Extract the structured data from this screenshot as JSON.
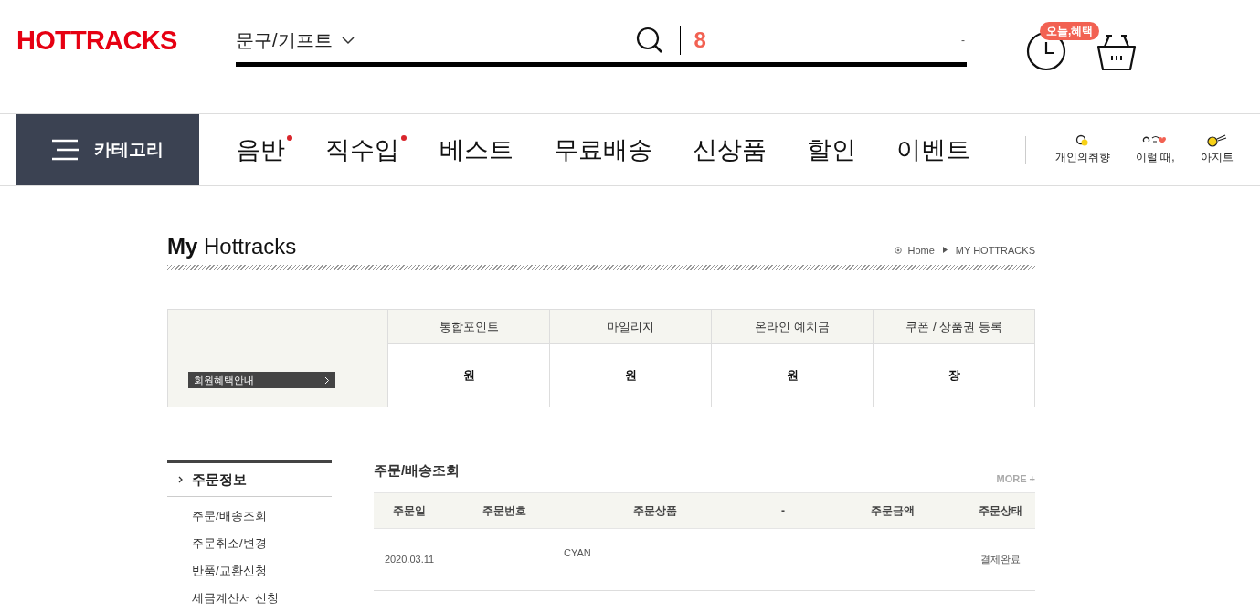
{
  "header": {
    "logo": "HOTTRACKS",
    "search": {
      "category": "문구/기프트",
      "value": "8",
      "hint": "-"
    },
    "badge": "오늘,혜택"
  },
  "nav": {
    "category_button": "카테고리",
    "items": [
      {
        "label": "음반",
        "new": true
      },
      {
        "label": "직수입",
        "new": true
      },
      {
        "label": "베스트",
        "new": false
      },
      {
        "label": "무료배송",
        "new": false
      },
      {
        "label": "신상품",
        "new": false
      },
      {
        "label": "할인",
        "new": false
      },
      {
        "label": "이벤트",
        "new": false
      }
    ],
    "shortcuts": [
      {
        "label": "개인의취향",
        "kind": "bubble"
      },
      {
        "label": "이럴 때,",
        "kind": "face"
      },
      {
        "label": "아지트",
        "kind": "ball"
      }
    ]
  },
  "page_title": {
    "bold": "My",
    "rest": "Hottracks"
  },
  "breadcrumb": [
    "Home",
    "MY HOTTRACKS"
  ],
  "summary": {
    "benefit_button": "회원혜택안내",
    "columns": [
      {
        "title": "통합포인트",
        "value": "원"
      },
      {
        "title": "마일리지",
        "value": "원"
      },
      {
        "title": "온라인 예치금",
        "value": "원"
      },
      {
        "title": "쿠폰 / 상품권 등록",
        "value": "장"
      }
    ]
  },
  "sidebar": {
    "title": "주문정보",
    "items": [
      "주문/배송조회",
      "주문취소/변경",
      "반품/교환신청",
      "세금계산서 신청"
    ]
  },
  "orders": {
    "title": "주문/배송조회",
    "more": "MORE +",
    "columns": [
      "주문일",
      "주문번호",
      "주문상품",
      "-",
      "주문금액",
      "주문상태"
    ],
    "rows": [
      [
        "2020.03.11",
        "",
        "CYAN",
        "",
        "",
        "결제완료"
      ]
    ]
  }
}
